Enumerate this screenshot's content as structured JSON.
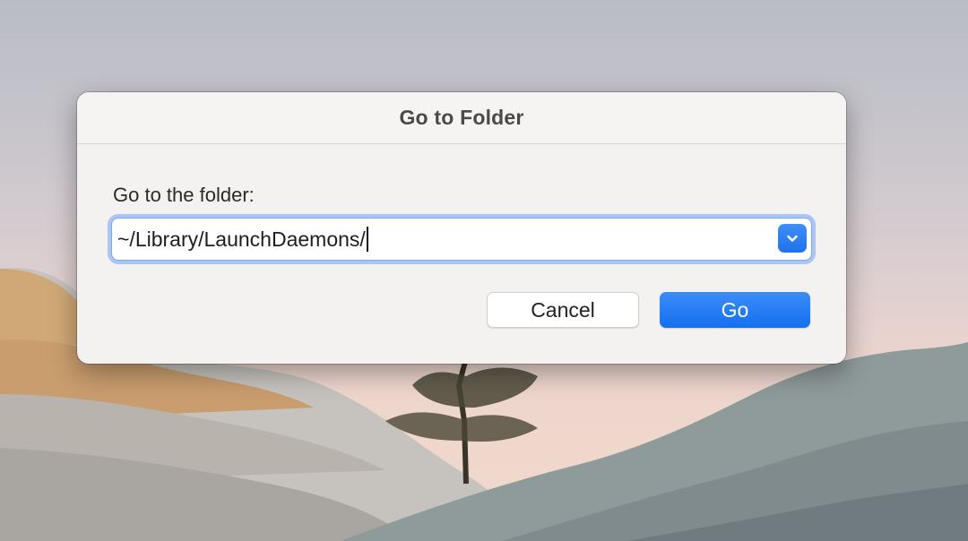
{
  "dialog": {
    "title": "Go to Folder",
    "prompt": "Go to the folder:",
    "path_value": "~/Library/LaunchDaemons/",
    "cancel_label": "Cancel",
    "go_label": "Go"
  },
  "icons": {
    "dropdown": "chevron-down-icon"
  },
  "colors": {
    "accent": "#1f72ea",
    "focus_ring": "#a9c6f5",
    "dialog_bg": "#f3f2f1"
  }
}
